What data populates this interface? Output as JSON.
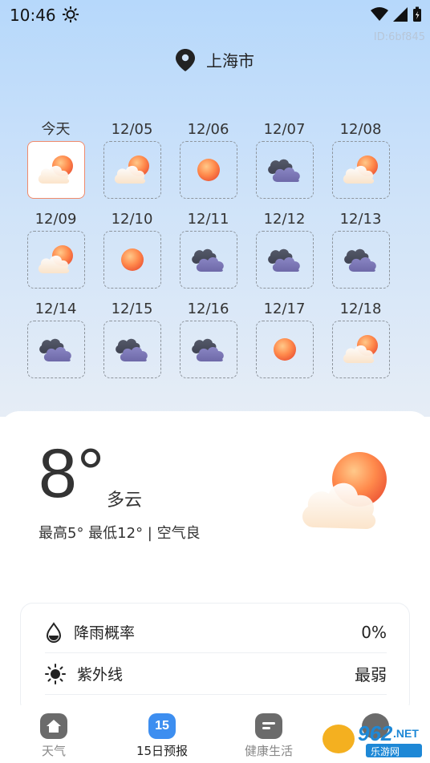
{
  "status_bar": {
    "time": "10:46",
    "id": "ID:6bf845"
  },
  "location": {
    "name": "上海市"
  },
  "forecast": [
    {
      "label": "今天",
      "icon": "partly-cloudy-icon",
      "selected": true
    },
    {
      "label": "12/05",
      "icon": "partly-cloudy-icon"
    },
    {
      "label": "12/06",
      "icon": "sunny-icon"
    },
    {
      "label": "12/07",
      "icon": "cloudy-icon"
    },
    {
      "label": "12/08",
      "icon": "partly-cloudy-icon"
    },
    {
      "label": "12/09",
      "icon": "partly-cloudy-icon"
    },
    {
      "label": "12/10",
      "icon": "sunny-icon"
    },
    {
      "label": "12/11",
      "icon": "cloudy-icon"
    },
    {
      "label": "12/12",
      "icon": "cloudy-icon"
    },
    {
      "label": "12/13",
      "icon": "cloudy-icon"
    },
    {
      "label": "12/14",
      "icon": "cloudy-icon"
    },
    {
      "label": "12/15",
      "icon": "cloudy-icon"
    },
    {
      "label": "12/16",
      "icon": "cloudy-icon"
    },
    {
      "label": "12/17",
      "icon": "sunny-icon"
    },
    {
      "label": "12/18",
      "icon": "partly-cloudy-icon"
    }
  ],
  "current": {
    "temp": "8°",
    "condition": "多云",
    "range": "最高5° 最低12° | 空气良"
  },
  "details": [
    {
      "label": "降雨概率",
      "value": "0%",
      "icon": "raindrop-icon"
    },
    {
      "label": "紫外线",
      "value": "最弱",
      "icon": "sun-outline-icon"
    }
  ],
  "nav": [
    {
      "label": "天气",
      "icon": "home-icon"
    },
    {
      "label": "15日预报",
      "icon": "calendar-15-icon",
      "badge": "15",
      "active": true
    },
    {
      "label": "健康生活",
      "icon": "notes-icon"
    }
  ],
  "colors": {
    "selected_border": "#f08a6b",
    "sky": "#b6d8fb",
    "nav_active": "#3d8ef0"
  }
}
